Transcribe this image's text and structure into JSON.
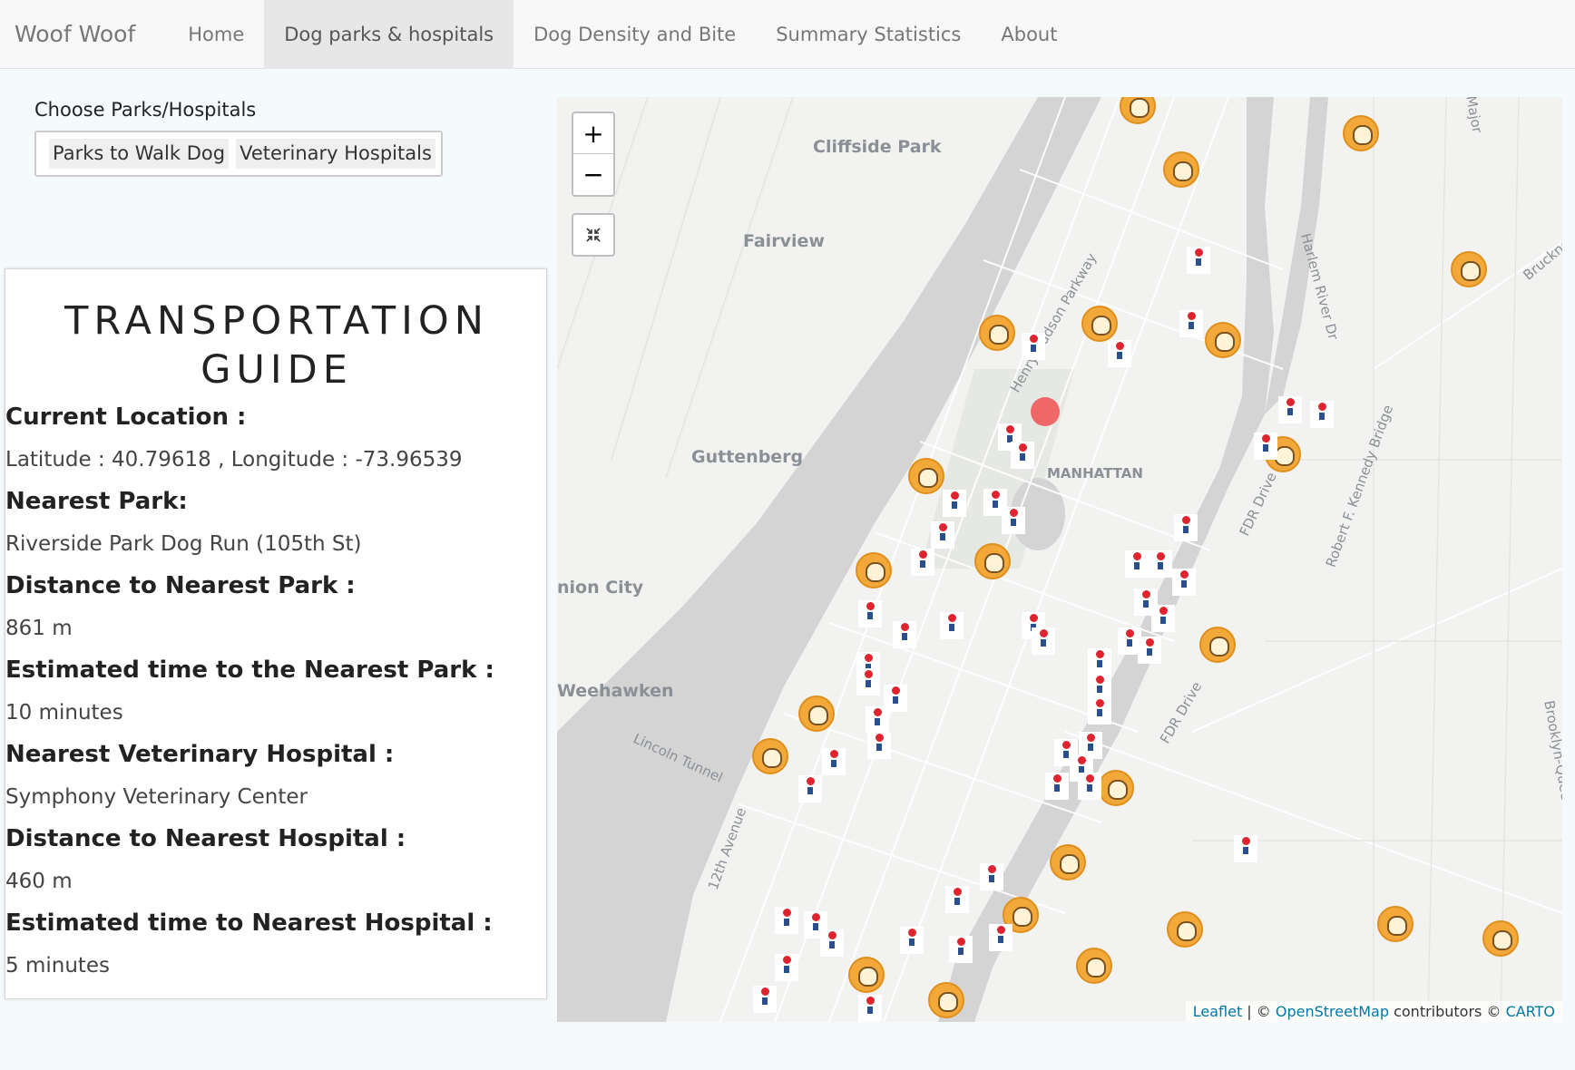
{
  "navbar": {
    "brand": "Woof Woof",
    "items": [
      {
        "label": "Home",
        "active": false
      },
      {
        "label": "Dog parks & hospitals",
        "active": true
      },
      {
        "label": "Dog Density and Bite",
        "active": false
      },
      {
        "label": "Summary Statistics",
        "active": false
      },
      {
        "label": "About",
        "active": false
      }
    ]
  },
  "chooser": {
    "label": "Choose Parks/Hospitals",
    "selected": [
      "Parks to Walk Dog",
      "Veterinary Hospitals"
    ]
  },
  "guide": {
    "title": "TRANSPORTATION GUIDE",
    "current_location_heading": "Current Location :",
    "current_location_value": "Latitude : 40.79618 , Longitude : -73.96539",
    "nearest_park_heading": "Nearest Park:",
    "nearest_park_value": "Riverside Park Dog Run (105th St)",
    "distance_park_heading": "Distance to Nearest Park :",
    "distance_park_value": "861 m",
    "time_park_heading": "Estimated time to the Nearest Park :",
    "time_park_value": "10 minutes",
    "nearest_hospital_heading": "Nearest Veterinary Hospital :",
    "nearest_hospital_value": "Symphony Veterinary Center",
    "distance_hospital_heading": "Distance to Nearest Hospital :",
    "distance_hospital_value": "460 m",
    "time_hospital_heading": "Estimated time to Nearest Hospital :",
    "time_hospital_value": "5 minutes"
  },
  "map": {
    "zoom_in": "+",
    "zoom_out": "−",
    "fit_icon": "collapse-icon",
    "labels": {
      "cliffside": "Cliffside Park",
      "fairview": "Fairview",
      "guttenberg": "Guttenberg",
      "union_city": "nion City",
      "weehawken": "Weehawken",
      "manhattan": "MANHATTAN",
      "hudson_pkwy": "Henry Hudson Parkway",
      "lincoln": "Lincoln Tunnel",
      "twelfth": "12th Avenue",
      "fdr1": "FDR Drive",
      "fdr2": "FDR Drive",
      "harlem": "Harlem River Dr",
      "rfk": "Robert F. Kennedy Bridge",
      "brooklyn_queens": "Brooklyn-Queens",
      "bruckner": "Bruckne",
      "major": "Major"
    },
    "attribution": {
      "leaflet": "Leaflet",
      "sep": " | © ",
      "osm": "OpenStreetMap",
      "contrib": " contributors © ",
      "carto": "CARTO"
    },
    "park_icon": "dog-park-marker-icon",
    "hospital_icon": "pet-hospital-marker-icon",
    "location_icon": "current-location-marker",
    "colors": {
      "park": "#f3a93a",
      "hospital": "#e0242f",
      "location": "#f05050",
      "water": "#d4d4d4",
      "land": "#f2f2f0"
    }
  }
}
